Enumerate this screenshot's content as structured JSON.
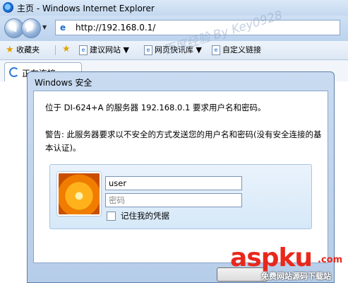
{
  "window": {
    "title": "主页 - Windows Internet Explorer"
  },
  "navigation": {
    "address": "http://192.168.0.1/"
  },
  "favorites_bar": {
    "favorites_label": "收藏夹",
    "items": [
      "建议网站 ▼",
      "网页快讯库 ▼",
      "自定义链接"
    ]
  },
  "tabs": [
    {
      "label": "正在连接..."
    }
  ],
  "dialog": {
    "title": "Windows 安全",
    "message": "位于 DI-624+A 的服务器 192.168.0.1 要求用户名和密码。",
    "warning": "警告: 此服务器要求以不安全的方式发送您的用户名和密码(没有安全连接的基本认证)。",
    "username_value": "user",
    "password_placeholder": "密码",
    "remember_label": "记住我的凭据"
  },
  "watermark": {
    "text": "百度经验 By Key0928"
  },
  "site_logo": {
    "main": "aspku",
    "suffix": ".com",
    "tagline": "免费网站源码下载站"
  },
  "colors": {
    "logo_red": "#e8281c",
    "chrome_blue": "#c3d8ef"
  }
}
